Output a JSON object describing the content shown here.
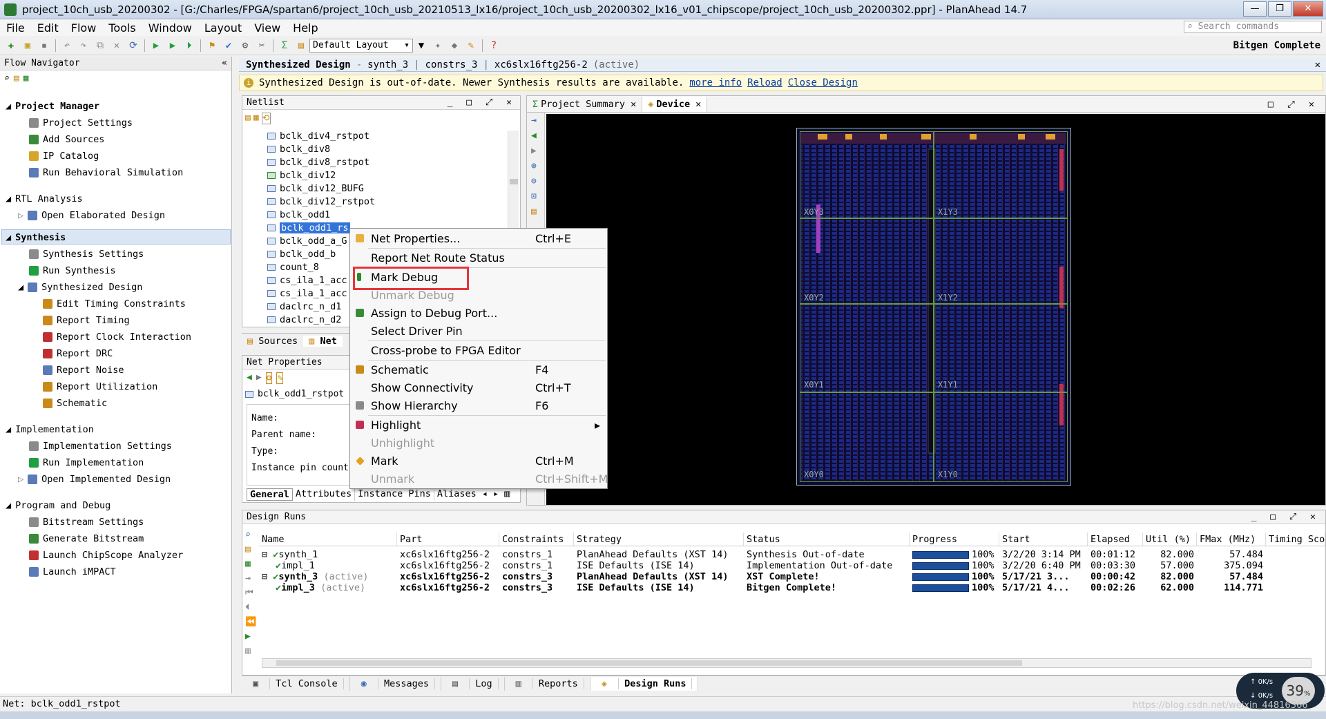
{
  "title_bar": {
    "text": "project_10ch_usb_20200302 - [G:/Charles/FPGA/spartan6/project_10ch_usb_20210513_lx16/project_10ch_usb_20200302_lx16_v01_chipscope/project_10ch_usb_20200302.ppr] - PlanAhead 14.7"
  },
  "menu": [
    "File",
    "Edit",
    "Flow",
    "Tools",
    "Window",
    "Layout",
    "View",
    "Help"
  ],
  "search_placeholder": "Search commands",
  "toolbar": {
    "layout_value": "Default Layout",
    "status_right": "Bitgen Complete"
  },
  "flow_navigator": {
    "title": "Flow Navigator",
    "project_manager": {
      "label": "Project Manager",
      "items": [
        "Project Settings",
        "Add Sources",
        "IP Catalog",
        "Run Behavioral Simulation"
      ]
    },
    "rtl_analysis": {
      "label": "RTL Analysis",
      "items": [
        "Open Elaborated Design"
      ]
    },
    "synthesis": {
      "label": "Synthesis",
      "items": [
        "Synthesis Settings",
        "Run Synthesis",
        "Synthesized Design"
      ],
      "sub_items": [
        "Edit Timing Constraints",
        "Report Timing",
        "Report Clock Interaction",
        "Report DRC",
        "Report Noise",
        "Report Utilization",
        "Schematic"
      ]
    },
    "implementation": {
      "label": "Implementation",
      "items": [
        "Implementation Settings",
        "Run Implementation",
        "Open Implemented Design"
      ]
    },
    "program_debug": {
      "label": "Program and Debug",
      "items": [
        "Bitstream Settings",
        "Generate Bitstream",
        "Launch ChipScope Analyzer",
        "Launch iMPACT"
      ]
    }
  },
  "main_header": {
    "title": "Synthesized Design",
    "sep": "-",
    "synth": "synth_3",
    "constrs": "constrs_3",
    "part": "xc6slx16ftg256-2",
    "active": "(active)"
  },
  "warning": {
    "text": "Synthesized Design is out-of-date. Newer Synthesis results are available.",
    "more_info": "more info",
    "reload": "Reload",
    "close": "Close Design"
  },
  "netlist": {
    "title": "Netlist",
    "rows": [
      "bclk_div4_rstpot",
      "bclk_div8",
      "bclk_div8_rstpot",
      "bclk_div12",
      "bclk_div12_BUFG",
      "bclk_div12_rstpot",
      "bclk_odd1",
      "bclk_odd1_rs",
      "bclk_odd_a_G",
      "bclk_odd_b",
      "count_8",
      "cs_ila_1_acc",
      "cs_ila_1_acc",
      "daclrc_n_d1",
      "daclrc_n_d2"
    ],
    "tabs": [
      "Sources",
      "Net"
    ]
  },
  "net_properties": {
    "title": "Net Properties",
    "net_name": "bclk_odd1_rstpot",
    "fields": [
      "Name:",
      "Parent name:",
      "Type:",
      "Instance pin count"
    ],
    "tabs": [
      "General",
      "Attributes",
      "Instance Pins",
      "Aliases"
    ]
  },
  "device_view": {
    "tabs": [
      "Project Summary",
      "Device"
    ],
    "region_labels": [
      "X0Y3",
      "X1Y3",
      "X0Y2",
      "X1Y2",
      "X0Y1",
      "X1Y1",
      "X0Y0",
      "X1Y0"
    ]
  },
  "context_menu": {
    "items": [
      {
        "label": "Net Properties...",
        "shortcut": "Ctrl+E"
      },
      {
        "label": "Report Net Route Status",
        "shortcut": ""
      },
      {
        "label": "Mark Debug",
        "shortcut": ""
      },
      {
        "label": "Unmark Debug",
        "shortcut": ""
      },
      {
        "label": "Assign to Debug Port...",
        "shortcut": ""
      },
      {
        "label": "Select Driver Pin",
        "shortcut": ""
      },
      {
        "label": "Cross-probe to FPGA Editor",
        "shortcut": ""
      },
      {
        "label": "Schematic",
        "shortcut": "F4"
      },
      {
        "label": "Show Connectivity",
        "shortcut": "Ctrl+T"
      },
      {
        "label": "Show Hierarchy",
        "shortcut": "F6"
      },
      {
        "label": "Highlight",
        "shortcut": ""
      },
      {
        "label": "Unhighlight",
        "shortcut": ""
      },
      {
        "label": "Mark",
        "shortcut": "Ctrl+M"
      },
      {
        "label": "Unmark",
        "shortcut": "Ctrl+Shift+M"
      }
    ]
  },
  "design_runs": {
    "title": "Design Runs",
    "columns": [
      "Name",
      "Part",
      "Constraints",
      "Strategy",
      "Status",
      "Progress",
      "Start",
      "Elapsed",
      "Util (%)",
      "FMax (MHz)",
      "Timing Sco"
    ],
    "rows": [
      {
        "name": "synth_1",
        "active": "",
        "part": "xc6slx16ftg256-2",
        "constraints": "constrs_1",
        "strategy": "PlanAhead Defaults (XST 14)",
        "status": "Synthesis Out-of-date",
        "progress": "100%",
        "start": "3/2/20 3:14 PM",
        "elapsed": "00:01:12",
        "util": "82.000",
        "fmax": "57.484"
      },
      {
        "name": "impl_1",
        "active": "",
        "part": "xc6slx16ftg256-2",
        "constraints": "constrs_1",
        "strategy": "ISE Defaults (ISE 14)",
        "status": "Implementation Out-of-date",
        "progress": "100%",
        "start": "3/2/20 6:40 PM",
        "elapsed": "00:03:30",
        "util": "57.000",
        "fmax": "375.094"
      },
      {
        "name": "synth_3",
        "active": "(active)",
        "part": "xc6slx16ftg256-2",
        "constraints": "constrs_3",
        "strategy": "PlanAhead Defaults (XST 14)",
        "status": "XST Complete!",
        "progress": "100%",
        "start": "5/17/21 3...",
        "elapsed": "00:00:42",
        "util": "82.000",
        "fmax": "57.484"
      },
      {
        "name": "impl_3",
        "active": "(active)",
        "part": "xc6slx16ftg256-2",
        "constraints": "constrs_3",
        "strategy": "ISE Defaults (ISE 14)",
        "status": "Bitgen Complete!",
        "progress": "100%",
        "start": "5/17/21 4...",
        "elapsed": "00:02:26",
        "util": "62.000",
        "fmax": "114.771"
      }
    ]
  },
  "bottom_tabs": [
    "Tcl Console",
    "Messages",
    "Log",
    "Reports",
    "Design Runs"
  ],
  "status_bar": "Net: bclk_odd1_rstpot",
  "speed_widget": {
    "percent": "39",
    "up": "0K/s",
    "down": "0K/s"
  },
  "watermark": "https://blog.csdn.net/weixin_44816366",
  "colors": {
    "accent": "#3474d8",
    "progress": "#1c4f9c",
    "highlight_box": "#e8343a",
    "warning_bg": "#fef9d8"
  }
}
